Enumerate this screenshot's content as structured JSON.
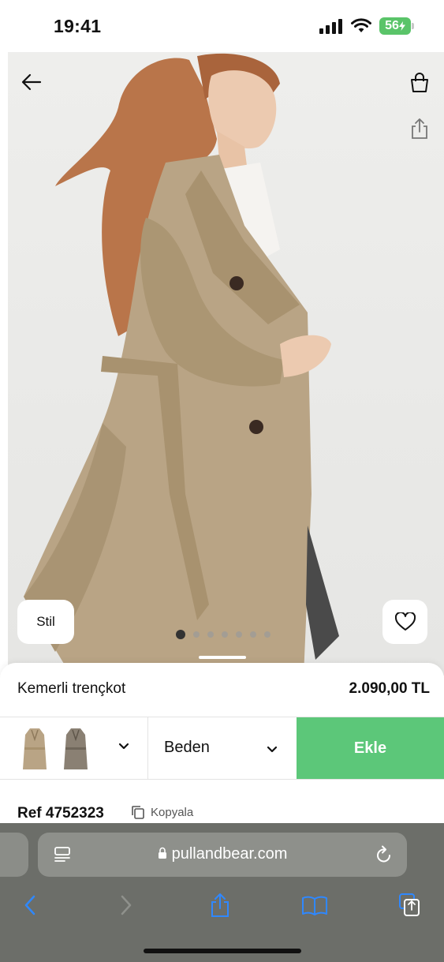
{
  "status_bar": {
    "time": "19:41",
    "battery": "56"
  },
  "hero": {
    "style_button_label": "Stil",
    "slide_count": 7,
    "active_slide": 1,
    "icons": [
      "back-arrow-icon",
      "shopping-bag-icon",
      "share-icon",
      "heart-icon"
    ]
  },
  "product": {
    "name": "Kemerli trençkot",
    "price": "2.090,00 TL",
    "size_label": "Beden",
    "add_label": "Ekle",
    "ref": "Ref 4752323",
    "copy_label": "Kopyala",
    "colors": [
      "beige",
      "grey"
    ]
  },
  "browser": {
    "url": "pullandbear.com"
  },
  "colors": {
    "add_button": "#5cc779",
    "coat_beige": "#b9a485",
    "safari_blue": "#2f88ff"
  }
}
